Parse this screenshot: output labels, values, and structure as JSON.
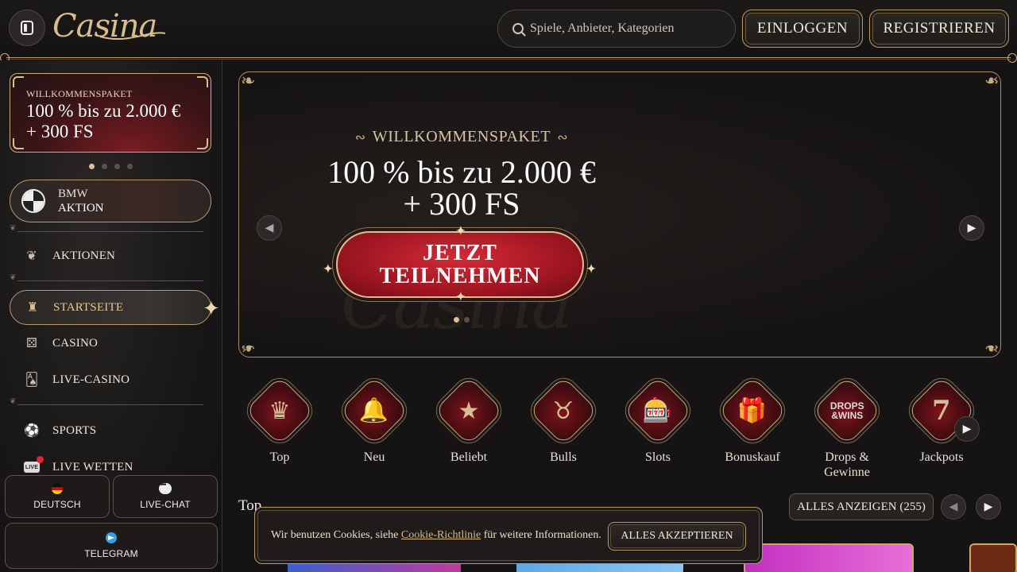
{
  "header": {
    "logo_text": "Casina",
    "search_placeholder": "Spiele, Anbieter, Kategorien",
    "login_label": "EINLOGGEN",
    "register_label": "REGISTRIEREN"
  },
  "sidebar": {
    "promo": {
      "kicker": "WILLKOMMENSPAKET",
      "line1": "100 % bis zu 2.000 €",
      "line2": "+ 300 FS"
    },
    "promo_dots": 4,
    "bmw": {
      "line1": "BMW",
      "line2": "AKTION"
    },
    "items": [
      {
        "label": "AKTIONEN",
        "icon": "tulip-icon"
      },
      {
        "label": "STARTSEITE",
        "icon": "castle-icon",
        "active": true
      },
      {
        "label": "CASINO",
        "icon": "casino-dice-icon"
      },
      {
        "label": "LIVE-CASINO",
        "icon": "cards-icon"
      },
      {
        "label": "SPORTS",
        "icon": "soccer-ball-icon"
      },
      {
        "label": "LIVE WETTEN",
        "icon": "live-badge-icon",
        "badge": "LIVE"
      }
    ],
    "language_label": "DEUTSCH",
    "livechat_label": "LIVE-CHAT",
    "telegram_label": "TELEGRAM"
  },
  "hero": {
    "kicker": "WILLKOMMENSPAKET",
    "title_line1": "100 % bis zu 2.000 €",
    "title_line2": "+ 300 FS",
    "cta_line1": "JETZT",
    "cta_line2": "TEILNEHMEN",
    "watermark": "Casina"
  },
  "categories": [
    {
      "label": "Top",
      "icon": "crown-icon",
      "glyph": "♛"
    },
    {
      "label": "Neu",
      "icon": "bell-icon",
      "glyph": "🔔"
    },
    {
      "label": "Beliebt",
      "icon": "star-icon",
      "glyph": "★"
    },
    {
      "label": "Bulls",
      "icon": "bull-icon",
      "glyph": "♉"
    },
    {
      "label": "Slots",
      "icon": "slot-machine-icon",
      "glyph": "🎰"
    },
    {
      "label": "Bonuskauf",
      "icon": "gift-icon",
      "glyph": "🎁"
    },
    {
      "label": "Drops &\nGewinne",
      "icon": "drops-wins-icon",
      "glyph": "DROPS\n&WINS"
    },
    {
      "label": "Jackpots",
      "icon": "seven-icon",
      "glyph": "7"
    }
  ],
  "section": {
    "title": "Top",
    "show_all": "ALLES ANZEIGEN (255)"
  },
  "cookie": {
    "text_before": "Wir benutzen Cookies, siehe ",
    "link": "Cookie-Richtlinie",
    "text_after": " für weitere Informationen.",
    "accept": "ALLES AKZEPTIEREN"
  },
  "colors": {
    "gold": "#c9ad7c",
    "accent_red": "#b51c28",
    "background": "#151313"
  }
}
